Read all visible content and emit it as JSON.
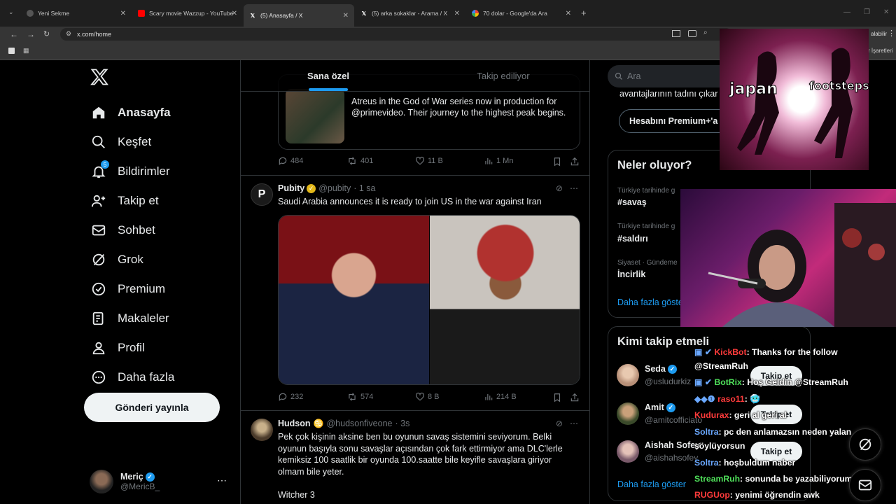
{
  "browser": {
    "tabs": [
      {
        "title": "Yeni Sekme",
        "icon": "globe-icon"
      },
      {
        "title": "Scary movie Wazzup - YouTube",
        "icon": "youtube-icon"
      },
      {
        "title": "(5) Anasayfa / X",
        "icon": "x-icon",
        "active": true
      },
      {
        "title": "(5) arka sokaklar - Arama / X",
        "icon": "x-icon"
      },
      {
        "title": "70 dolar - Google'da Ara",
        "icon": "google-icon"
      }
    ],
    "url": "x.com/home",
    "bookmark_right": "r İşaretleri",
    "ext_label": "alabilir"
  },
  "nav": {
    "items": [
      {
        "label": "Anasayfa",
        "icon": "home-icon",
        "active": true
      },
      {
        "label": "Keşfet",
        "icon": "search-icon"
      },
      {
        "label": "Bildirimler",
        "icon": "bell-icon",
        "badge": "5"
      },
      {
        "label": "Takip et",
        "icon": "add-user-icon"
      },
      {
        "label": "Sohbet",
        "icon": "mail-icon"
      },
      {
        "label": "Grok",
        "icon": "grok-icon"
      },
      {
        "label": "Premium",
        "icon": "premium-icon"
      },
      {
        "label": "Makaleler",
        "icon": "article-icon"
      },
      {
        "label": "Profil",
        "icon": "person-icon"
      },
      {
        "label": "Daha fazla",
        "icon": "more-circle-icon"
      }
    ],
    "post_button": "Gönderi yayınla",
    "account": {
      "name": "Meriç",
      "handle": "@MericB_"
    }
  },
  "feed": {
    "tabs": [
      "Sana özel",
      "Takip ediliyor"
    ],
    "quoted_text": "Atreus in the God of War series now in production for @primevideo. Their journey to the highest peak begins.",
    "tweets": [
      {
        "stats": {
          "replies": "484",
          "retweets": "401",
          "likes": "11 B",
          "views": "1 Mn"
        }
      },
      {
        "name": "Pubity",
        "handle": "@pubity",
        "time": "· 1 sa",
        "text": "Saudi Arabia announces it is ready to join US in the war against Iran",
        "stats": {
          "replies": "232",
          "retweets": "574",
          "likes": "8 B",
          "views": "214 B"
        }
      },
      {
        "name": "Hudson",
        "handle": "@hudsonfiveone",
        "time": "· 3s",
        "text": "Pek çok kişinin aksine ben bu oyunun savaş sistemini seviyorum. Belki oyunun başıyla sonu savaşlar açısından çok fark ettirmiyor ama DLC'lerle kemiksiz 100 saatlik bir oyunda 100.saatte bile keyifle savaşlara giriyor olmam bile yeter.",
        "text2": "Witcher 3"
      }
    ]
  },
  "right": {
    "search_placeholder": "Ara",
    "premium_text": "avantajlarının tadını çıkar",
    "premium_button": "Hesabını Premium+'a",
    "trends_title": "Neler oluyor?",
    "trends": [
      {
        "context": "Türkiye tarihinde g",
        "title": "#savaş"
      },
      {
        "context": "Türkiye tarihinde g",
        "title": "#saldırı"
      },
      {
        "context": "Siyaset · Gündeme",
        "title": "İncirlik"
      }
    ],
    "trends_more": "Daha fazla göste",
    "who_title": "Kimi takip etmeli",
    "who": [
      {
        "name": "Seda",
        "handle": "@usludurkiz"
      },
      {
        "name": "Amit",
        "handle": "@amitcofficiato"
      },
      {
        "name": "Aishah Sofey",
        "handle": "@aishahsofey"
      }
    ],
    "follow_label": "Takip et",
    "who_more": "Daha fazla göster"
  },
  "overlay": {
    "meme_words": [
      "japan",
      "footsteps"
    ],
    "chat": [
      {
        "user": "KickBot",
        "color": "#ff3b3b",
        "msg": ": Thanks for the follow"
      },
      {
        "user": "",
        "color": "#ffffff",
        "msg": "@StreamRuh"
      },
      {
        "user": "BotRix",
        "color": "#4fe05a",
        "msg": ": Hoş Geldin @StreamRuh"
      },
      {
        "user": "raso11",
        "color": "#ff3b3b",
        "msg": ": 🥶"
      },
      {
        "user": "Kudurax",
        "color": "#ff3b3b",
        "msg": ": geri al geri al"
      },
      {
        "user": "Soltra",
        "color": "#6aa8ff",
        "msg": ": pc den anlamazsın neden yalan"
      },
      {
        "user": "",
        "color": "#ffffff",
        "msg": "söylüyorsun"
      },
      {
        "user": "Soltra",
        "color": "#6aa8ff",
        "msg": ": hoşbuldum naber"
      },
      {
        "user": "StreamRuh",
        "color": "#4fe05a",
        "msg": ": sonunda be yazabiliyorum"
      },
      {
        "user": "RUGUop",
        "color": "#ff3b3b",
        "msg": ": yenimi öğrendin awk"
      }
    ]
  }
}
